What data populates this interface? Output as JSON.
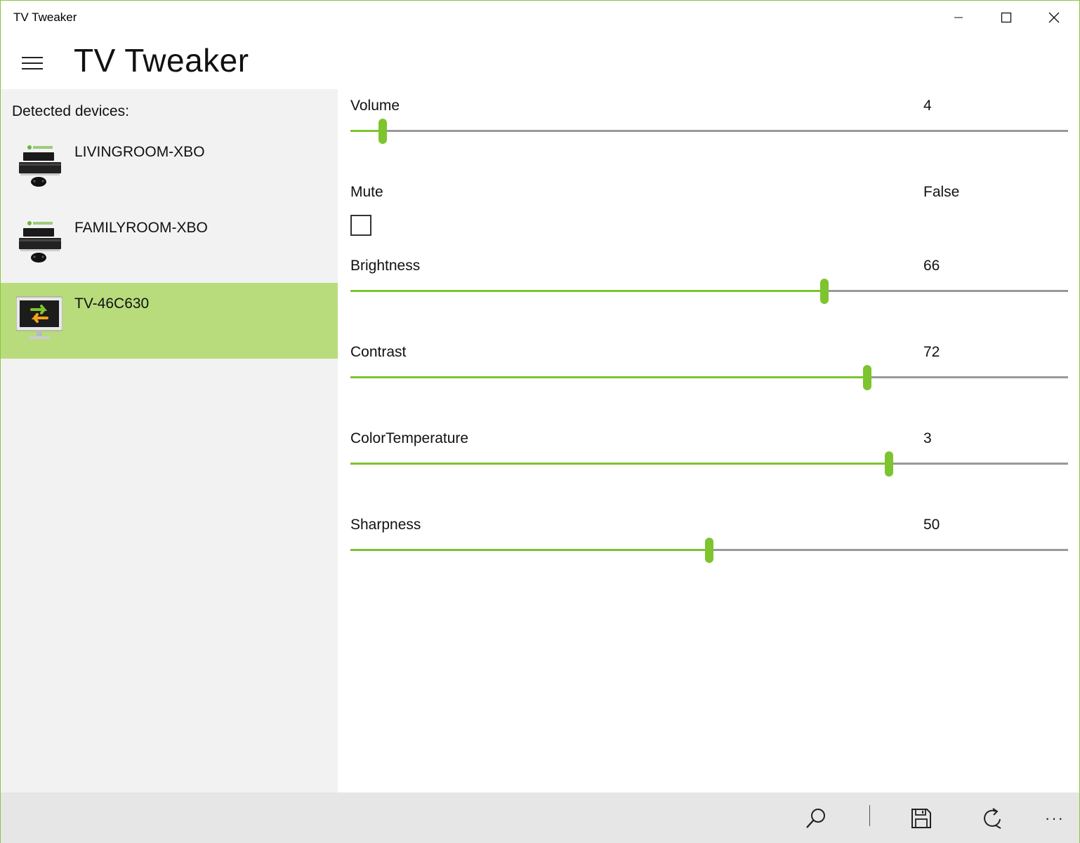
{
  "window": {
    "title": "TV Tweaker"
  },
  "header": {
    "app_title": "TV Tweaker"
  },
  "devices_pane": {
    "label": "Detected devices:",
    "devices": [
      {
        "name": "LIVINGROOM-XBO",
        "icon": "xbox-one-icon",
        "selected": false
      },
      {
        "name": "FAMILYROOM-XBO",
        "icon": "xbox-one-icon",
        "selected": false
      },
      {
        "name": "TV-46C630",
        "icon": "tv-sync-icon",
        "selected": true
      }
    ]
  },
  "settings": {
    "volume": {
      "label": "Volume",
      "value": "4",
      "fraction": 0.045
    },
    "mute": {
      "label": "Mute",
      "value": "False",
      "checked": false
    },
    "brightness": {
      "label": "Brightness",
      "value": "66",
      "fraction": 0.66
    },
    "contrast": {
      "label": "Contrast",
      "value": "72",
      "fraction": 0.72
    },
    "color_temperature": {
      "label": "ColorTemperature",
      "value": "3",
      "fraction": 0.75
    },
    "sharpness": {
      "label": "Sharpness",
      "value": "50",
      "fraction": 0.5
    }
  },
  "command_bar": {
    "buttons": [
      "search-icon",
      "save-icon",
      "refresh-icon",
      "more-icon"
    ],
    "more_label": "···"
  },
  "colors": {
    "accent": "#7dc42f",
    "selection": "#b8dc7c",
    "pane_background": "#f2f2f2",
    "command_bar_background": "#e6e6e6",
    "window_border": "#8cc63f"
  }
}
